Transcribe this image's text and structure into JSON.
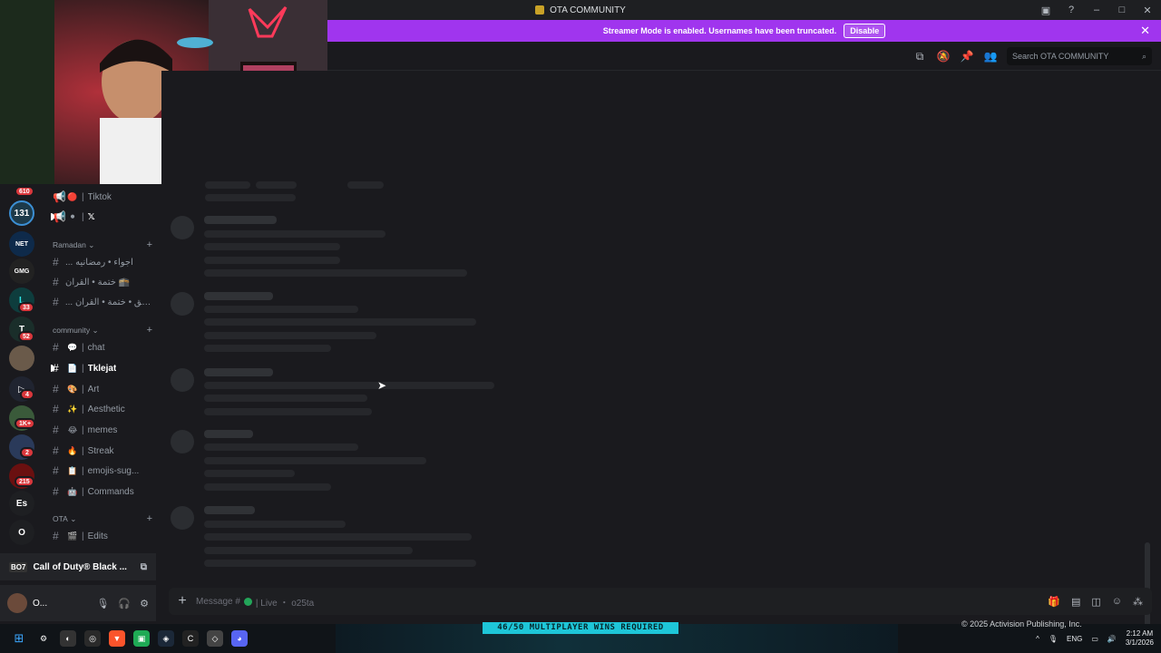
{
  "window": {
    "title": "OTA COMMUNITY"
  },
  "banner": {
    "text": "Streamer Mode is enabled. Usernames have been truncated.",
    "button": "Disable"
  },
  "search": {
    "placeholder": "Search OTA COMMUNITY"
  },
  "rail": {
    "badges": [
      "610",
      "33",
      "52",
      "4",
      "1K+",
      "2",
      "215"
    ],
    "letters": [
      "Es",
      "O"
    ]
  },
  "channels": {
    "top": [
      {
        "name": "Tiktok",
        "icon": "megaphone-icon"
      },
      {
        "name": "𝕏",
        "icon": "megaphone-icon"
      }
    ],
    "categories": {
      "ramadan": "Ramadan",
      "community": "community",
      "ota": "OTA"
    },
    "ramadan_items": [
      "... اجواء • رمضانيه",
      "ختمة • القرآن 🕋",
      "... فريق • ختمة • القرآن"
    ],
    "community_items": [
      {
        "emoji": "💬",
        "name": "chat"
      },
      {
        "emoji": "📄",
        "name": "Tklejat"
      },
      {
        "emoji": "🎨",
        "name": "Art"
      },
      {
        "emoji": "✨",
        "name": "Aesthetic"
      },
      {
        "emoji": "😂",
        "name": "memes"
      },
      {
        "emoji": "🔥",
        "name": "Streak"
      },
      {
        "emoji": "📋",
        "name": "emojis-sug..."
      },
      {
        "emoji": "🤖",
        "name": "Commands"
      }
    ],
    "ota_items": [
      {
        "emoji": "🎬",
        "name": "Edits"
      }
    ]
  },
  "activity": {
    "game": "Call of Duty® Black ...",
    "tag": "BO7"
  },
  "user": {
    "name": "O..."
  },
  "composer": {
    "placeholder": "Message #",
    "status": "| Live ・ o25ta"
  },
  "game_overlay": {
    "challenge": "46/50 MULTIPLAYER WINS REQUIRED",
    "copyright": "© 2025 Activision Publishing, Inc."
  },
  "taskbar": {
    "lang": "ENG",
    "time": "2:12 AM",
    "date": "3/1/2026"
  },
  "colors": {
    "banner": "#a035ee",
    "badge": "#da373c",
    "online": "#23a559",
    "challenge": "#1ec6d8"
  }
}
